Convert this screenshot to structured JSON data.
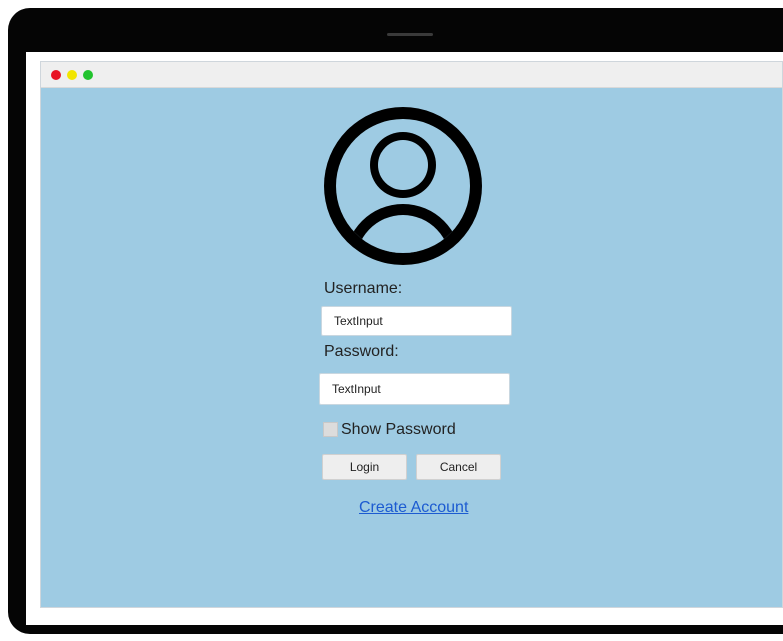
{
  "window": {
    "traffic_lights": {
      "close_color": "#e81123",
      "minimize_color": "#f2e500",
      "maximize_color": "#22c32e"
    },
    "background_color": "#9ecbe3"
  },
  "login_form": {
    "avatar_icon": "user-avatar-icon",
    "username_label": "Username:",
    "username_value": "TextInput",
    "password_label": "Password:",
    "password_value": "TextInput",
    "show_password_label": "Show Password",
    "show_password_checked": false,
    "login_label": "Login",
    "cancel_label": "Cancel",
    "create_account_label": "Create Account"
  }
}
